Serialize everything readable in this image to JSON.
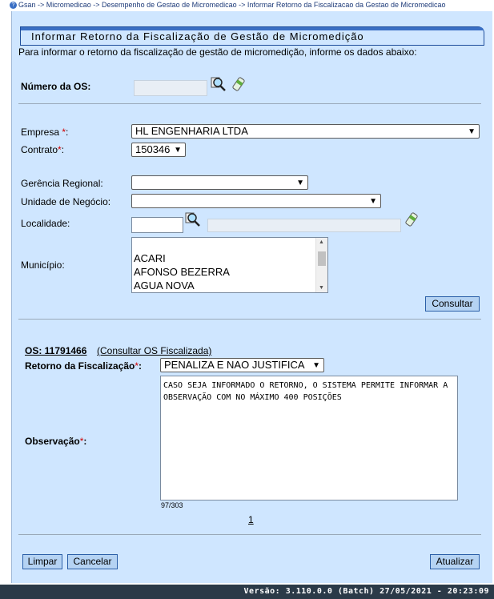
{
  "breadcrumb": "Gsan -> Micromedicao -> Desempenho de Gestao de Micromedicao -> Informar Retorno da Fiscalizacao da Gestao de Micromedicao",
  "title": "Informar Retorno da Fiscalização de Gestão de Micromedição",
  "instructions": "Para informar o retorno da fiscalização de gestão de micromedição, informe os dados abaixo:",
  "os_field": {
    "label": "Número da OS:",
    "value": "",
    "search_icon": "magnifier-icon",
    "clear_icon": "eraser-icon"
  },
  "empresa": {
    "label": "Empresa ",
    "required": "*",
    "colon": ":",
    "value": "HL ENGENHARIA LTDA"
  },
  "contrato": {
    "label": "Contrato",
    "required": "*",
    "colon": ":",
    "value": "150346"
  },
  "gerencia": {
    "label": "Gerência Regional:",
    "value": ""
  },
  "unidade": {
    "label": "Unidade de Negócio:",
    "value": ""
  },
  "localidade": {
    "label": "Localidade:",
    "value": "",
    "description": ""
  },
  "municipio": {
    "label": "Município:",
    "options": [
      "",
      "ACARI",
      "AFONSO BEZERRA",
      "AGUA NOVA"
    ]
  },
  "consultar_button": "Consultar",
  "os_info": {
    "label": "OS: 11791466",
    "link": "(Consultar OS Fiscalizada)"
  },
  "retorno": {
    "label": "Retorno da Fiscalização",
    "required": "*",
    "colon": ":",
    "value": "PENALIZA E NAO JUSTIFICA"
  },
  "observacao": {
    "label": "Observação",
    "required": "*",
    "colon": ":",
    "value": "CASO SEJA INFORMADO O RETORNO, O SISTEMA PERMITE INFORMAR A OBSERVAÇÃO COM NO MÁXIMO 400 POSIÇÕES",
    "counter": "97/303"
  },
  "pagination": "1",
  "buttons": {
    "limpar": "Limpar",
    "cancelar": "Cancelar",
    "atualizar": "Atualizar"
  },
  "footer": "Versão: 3.110.0.0 (Batch) 27/05/2021 - 20:23:09",
  "colors": {
    "panel_bg": "#cfe6ff",
    "title_bar": "#3a6fc4",
    "footer_bg": "#2b3a48",
    "required": "#d00000"
  }
}
